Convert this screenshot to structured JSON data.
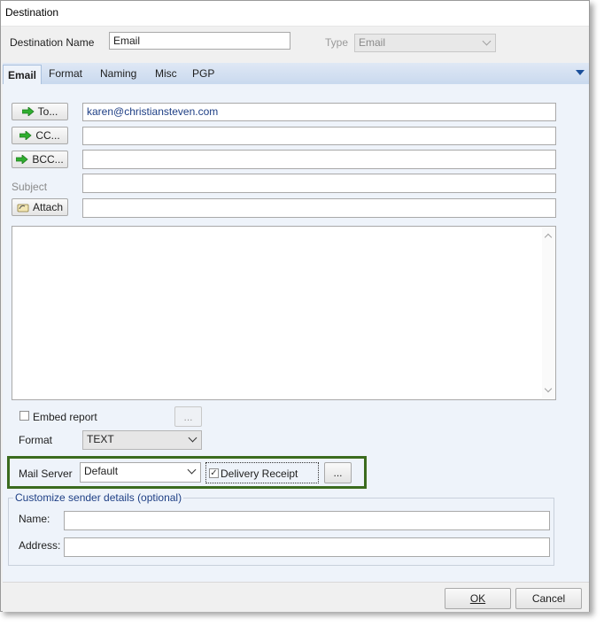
{
  "window": {
    "title": "Destination"
  },
  "header": {
    "destination_name_label": "Destination Name",
    "destination_name_value": "Email",
    "type_label": "Type",
    "type_value": "Email"
  },
  "tabs": [
    {
      "label": "Email",
      "active": true
    },
    {
      "label": "Format",
      "active": false
    },
    {
      "label": "Naming",
      "active": false
    },
    {
      "label": "Misc",
      "active": false
    },
    {
      "label": "PGP",
      "active": false
    }
  ],
  "email": {
    "to_button": "To...",
    "to_value": "karen@christiansteven.com",
    "cc_button": "CC...",
    "cc_value": "",
    "bcc_button": "BCC...",
    "bcc_value": "",
    "subject_label": "Subject",
    "subject_value": "",
    "attach_button": "Attach",
    "attach_value": "",
    "body_value": "",
    "embed_report_label": "Embed report",
    "embed_report_checked": false,
    "embed_options_button": "...",
    "format_label": "Format",
    "format_value": "TEXT",
    "mail_server_label": "Mail Server",
    "mail_server_value": "Default",
    "delivery_receipt_label": "Delivery Receipt",
    "delivery_receipt_checked": true,
    "delivery_options_button": "..."
  },
  "sender": {
    "group_title": "Customize sender details (optional)",
    "name_label": "Name:",
    "name_value": "",
    "address_label": "Address:",
    "address_value": ""
  },
  "footer": {
    "ok_button": "OK",
    "cancel_button": "Cancel"
  },
  "colors": {
    "tab_bar": "#c9d9ee",
    "panel": "#eef3fa",
    "highlight_box": "#3b6b1e",
    "arrow_icon": "#2fae2f",
    "link_text": "#1e3f85"
  }
}
